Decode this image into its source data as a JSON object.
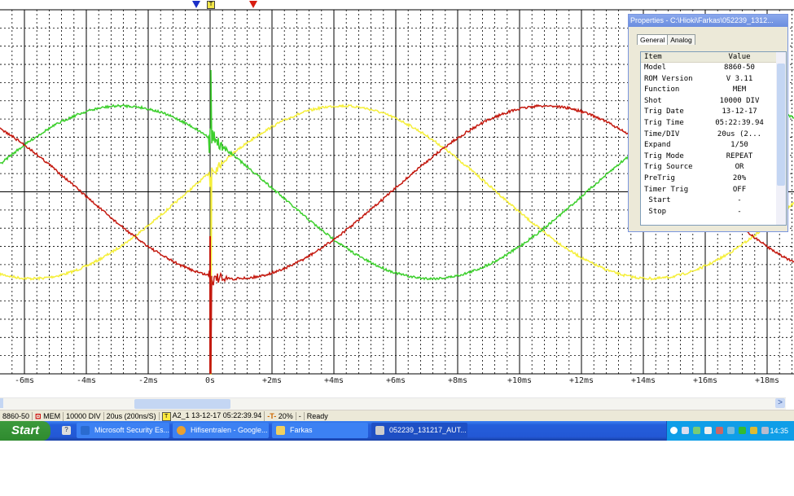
{
  "waveform": {
    "x_labels": [
      "-6ms",
      "-4ms",
      "-2ms",
      "0s",
      "+2ms",
      "+4ms",
      "+6ms",
      "+8ms",
      "+10ms",
      "+12ms",
      "+14ms",
      "+16ms",
      "+18ms"
    ],
    "colors": {
      "red": "#c41a10",
      "green": "#3ccf2c",
      "yellow": "#f5ef3a",
      "grid": "#000000"
    },
    "trigger_marker": "T"
  },
  "properties": {
    "title": "Properties - C:\\Hioki\\Farkas\\052239_1312...",
    "tabs": [
      "General",
      "Analog"
    ],
    "header": [
      "Item",
      "Value"
    ],
    "rows": [
      [
        "Model",
        "8860-50"
      ],
      [
        "ROM Version",
        "V 3.11"
      ],
      [
        "Function",
        "MEM"
      ],
      [
        "Shot",
        "10000 DIV"
      ],
      [
        "Trig Date",
        "13-12-17"
      ],
      [
        "Trig Time",
        "05:22:39.94"
      ],
      [
        "Time/DIV",
        "20us (2..."
      ],
      [
        "Expand",
        "1/50"
      ],
      [
        "Trig Mode",
        "REPEAT"
      ],
      [
        "Trig Source",
        "OR"
      ],
      [
        "PreTrig",
        "20%"
      ],
      [
        "Timer Trig",
        "OFF"
      ],
      [
        " Start",
        "-"
      ],
      [
        " Stop",
        "-"
      ]
    ]
  },
  "status": {
    "model": "8860-50",
    "function": "MEM",
    "shot": "10000 DIV",
    "timediv": "20us (200ns/S)",
    "trig_icon": "T",
    "trig": "A2_1 13-12-17 05:22:39.94",
    "pretrig": "20%",
    "dash": "-",
    "state": "Ready"
  },
  "taskbar": {
    "start": "Start",
    "items": [
      "Microsoft Security Es...",
      "Hifisentralen - Google...",
      "Farkas",
      "052239_131217_AUT..."
    ],
    "clock": "14:35"
  }
}
